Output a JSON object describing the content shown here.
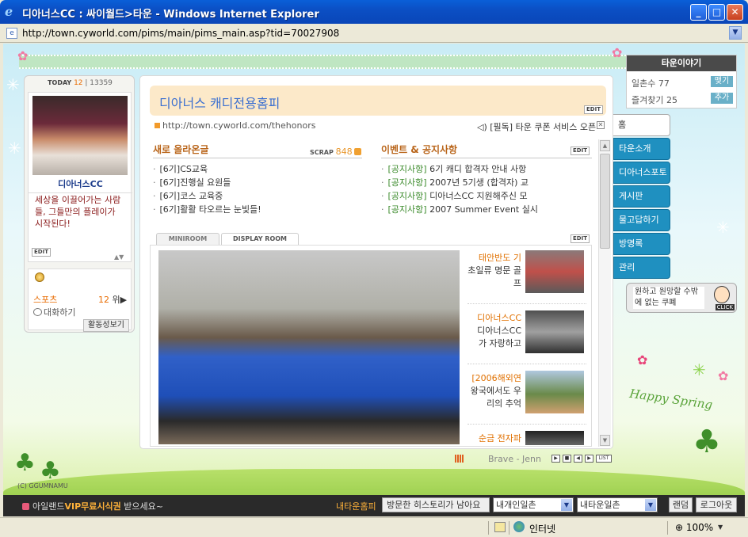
{
  "window": {
    "title": "디아너스CC : 싸이월드>타운 - Windows Internet Explorer",
    "url": "http://town.cyworld.com/pims/main/pims_main.asp?tid=70027908"
  },
  "profile": {
    "today_label": "TODAY",
    "today_count": "12",
    "total_count": "13359",
    "name": "디아너스CC",
    "message": "세상을 이끌어가는 사람들, 그들만의 플레이가 시작된다!",
    "edit_label": "EDIT",
    "sports_label": "스포츠",
    "sports_rank": "12",
    "sports_rank_suffix": "위▶",
    "chat_label": "대화하기",
    "activity_button": "활동성보기"
  },
  "main": {
    "homepage_title": "디아너스 캐디전용홈피",
    "edit_label": "EDIT",
    "site_url": "http://town.cyworld.com/thehonors",
    "notice": "[필독] 타운 쿠폰 서비스 오픈",
    "new_posts": {
      "heading": "새로 올라온글",
      "scrap_label": "SCRAP",
      "scrap_count": "848",
      "items": [
        "[6기]CS교육",
        "[6기]진행실 요원들",
        "[6기]코스 교육중",
        "[6기]활활 타오르는 눈빛들!"
      ]
    },
    "events": {
      "heading": "이벤트 & 공지사항",
      "items": [
        {
          "tag": "[공지사항]",
          "text": " 6기 캐디 합격자 안내 사항"
        },
        {
          "tag": "[공지사항]",
          "text": " 2007년 5기생 (합격자) 교"
        },
        {
          "tag": "[공지사항]",
          "text": " 디아너스CC 지원해주신 모"
        },
        {
          "tag": "[공지사항]",
          "text": " 2007 Summer Event 실시"
        }
      ]
    },
    "tabs": [
      "MINIROOM",
      "DISPLAY ROOM"
    ],
    "thumbs": [
      {
        "hl": "태안반도 기",
        "rest": "초일류 명문 골프"
      },
      {
        "hl": "디아너스CC",
        "rest": "디아너스CC 가 자랑하고"
      },
      {
        "hl": "[2006해외연",
        "rest": "왕국에서도 우 리의 추억"
      },
      {
        "hl": "순금 전자파",
        "rest": ""
      }
    ]
  },
  "right": {
    "story_title": "타운이야기",
    "members_label": "일촌수",
    "members_count": "77",
    "members_button": "맺기",
    "favorites_label": "즐겨찾기",
    "favorites_count": "25",
    "favorites_button": "추가",
    "nav": [
      "홈",
      "타운소개",
      "디아너스포토",
      "게시판",
      "물고답하기",
      "방명록",
      "관리"
    ],
    "promo_text": "원하고 원망할 수밖에 없는 쿠폐",
    "promo_click": "CLICK"
  },
  "player": {
    "track": "Brave - Jenn",
    "list_label": "LIST"
  },
  "footer": {
    "copyright": "(C) GGUMNAMU",
    "promo_prefix": "아일랜드",
    "promo_vip": "VIP무료시식권",
    "promo_suffix": " 받으세요~",
    "my_town": "내타운홈피",
    "history": "방문한 히스토리가 남아요",
    "select_one": "내개인일촌",
    "select_two": "내타운일촌",
    "random_button": "랜덤",
    "logout_button": "로그아웃"
  },
  "statusbar": {
    "zone": "인터넷",
    "zoom": "100%"
  },
  "colors": {
    "title_bar": "#0b4fc4",
    "nav_tab": "#1f90c0",
    "accent_orange": "#e86b00",
    "notice_green": "#3a8a2a"
  }
}
